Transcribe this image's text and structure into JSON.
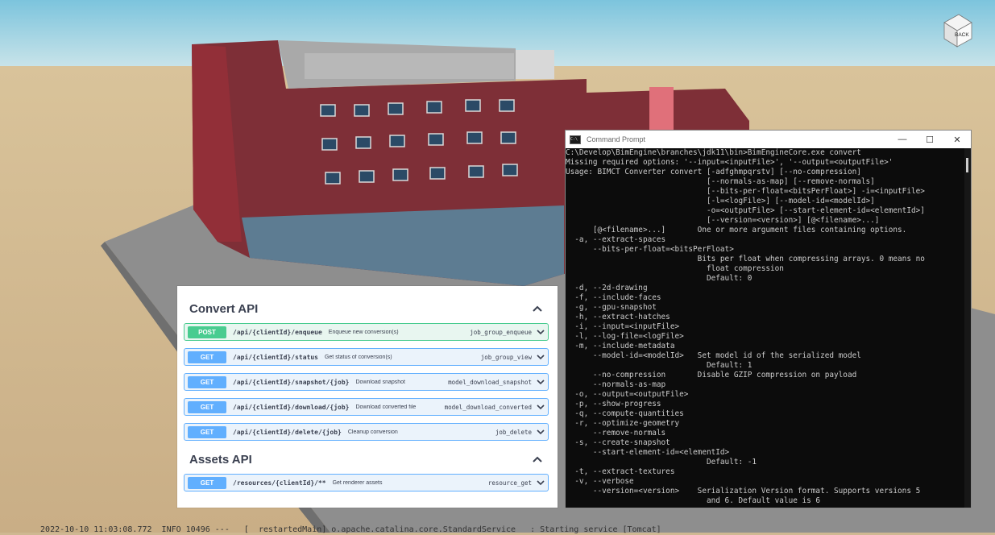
{
  "viewer": {
    "nav_cube_face": "BACK",
    "log_line": "  2022-10-10 11:03:08.772  INFO 10496 ---   [  restartedMain] o.apache.catalina.core.StandardService   : Starting service [Tomcat]"
  },
  "swagger": {
    "sections": [
      {
        "title": "Convert API",
        "operations": [
          {
            "method": "POST",
            "path": "/api/{clientId}/enqueue",
            "summary": "Enqueue new conversion(s)",
            "operation_id": "job_group_enqueue"
          },
          {
            "method": "GET",
            "path": "/api/{clientId}/status",
            "summary": "Get status of conversion(s)",
            "operation_id": "job_group_view"
          },
          {
            "method": "GET",
            "path": "/api/{clientId}/snapshot/{job}",
            "summary": "Download snapshot",
            "operation_id": "model_download_snapshot"
          },
          {
            "method": "GET",
            "path": "/api/{clientId}/download/{job}",
            "summary": "Download converted file",
            "operation_id": "model_download_converted"
          },
          {
            "method": "GET",
            "path": "/api/{clientId}/delete/{job}",
            "summary": "Cleanup conversion",
            "operation_id": "job_delete"
          }
        ]
      },
      {
        "title": "Assets API",
        "operations": [
          {
            "method": "GET",
            "path": "/resources/{clientId}/**",
            "summary": "Get renderer assets",
            "operation_id": "resource_get"
          }
        ]
      }
    ]
  },
  "cmd": {
    "icon_text": "C:\\",
    "title": "Command Prompt",
    "minimize": "—",
    "maximize": "☐",
    "close": "✕",
    "lines": [
      "C:\\Develop\\BimEngine\\branches\\jdk11\\bin>BimEngineCore.exe convert",
      "Missing required options: '--input=<inputFile>', '--output=<outputFile>'",
      "Usage: BIMCT Converter convert [-adfghmpqrstv] [--no-compression]",
      "                               [--normals-as-map] [--remove-normals]",
      "                               [--bits-per-float=<bitsPerFloat>] -i=<inputFile>",
      "                               [-l=<logFile>] [--model-id=<modelId>]",
      "                               -o=<outputFile> [--start-element-id=<elementId>]",
      "                               [--version=<version>] [@<filename>...]",
      "      [@<filename>...]       One or more argument files containing options.",
      "  -a, --extract-spaces",
      "      --bits-per-float=<bitsPerFloat>",
      "                             Bits per float when compressing arrays. 0 means no",
      "                               float compression",
      "                               Default: 0",
      "  -d, --2d-drawing",
      "  -f, --include-faces",
      "  -g, --gpu-snapshot",
      "  -h, --extract-hatches",
      "  -i, --input=<inputFile>",
      "  -l, --log-file=<logFile>",
      "  -m, --include-metadata",
      "      --model-id=<modelId>   Set model id of the serialized model",
      "                               Default: 1",
      "      --no-compression       Disable GZIP compression on payload",
      "      --normals-as-map",
      "  -o, --output=<outputFile>",
      "  -p, --show-progress",
      "  -q, --compute-quantities",
      "  -r, --optimize-geometry",
      "      --remove-normals",
      "  -s, --create-snapshot",
      "      --start-element-id=<elementId>",
      "                               Default: -1",
      "  -t, --extract-textures",
      "  -v, --verbose",
      "      --version=<version>    Serialization Version format. Supports versions 5",
      "                               and 6. Default value is 6"
    ]
  }
}
